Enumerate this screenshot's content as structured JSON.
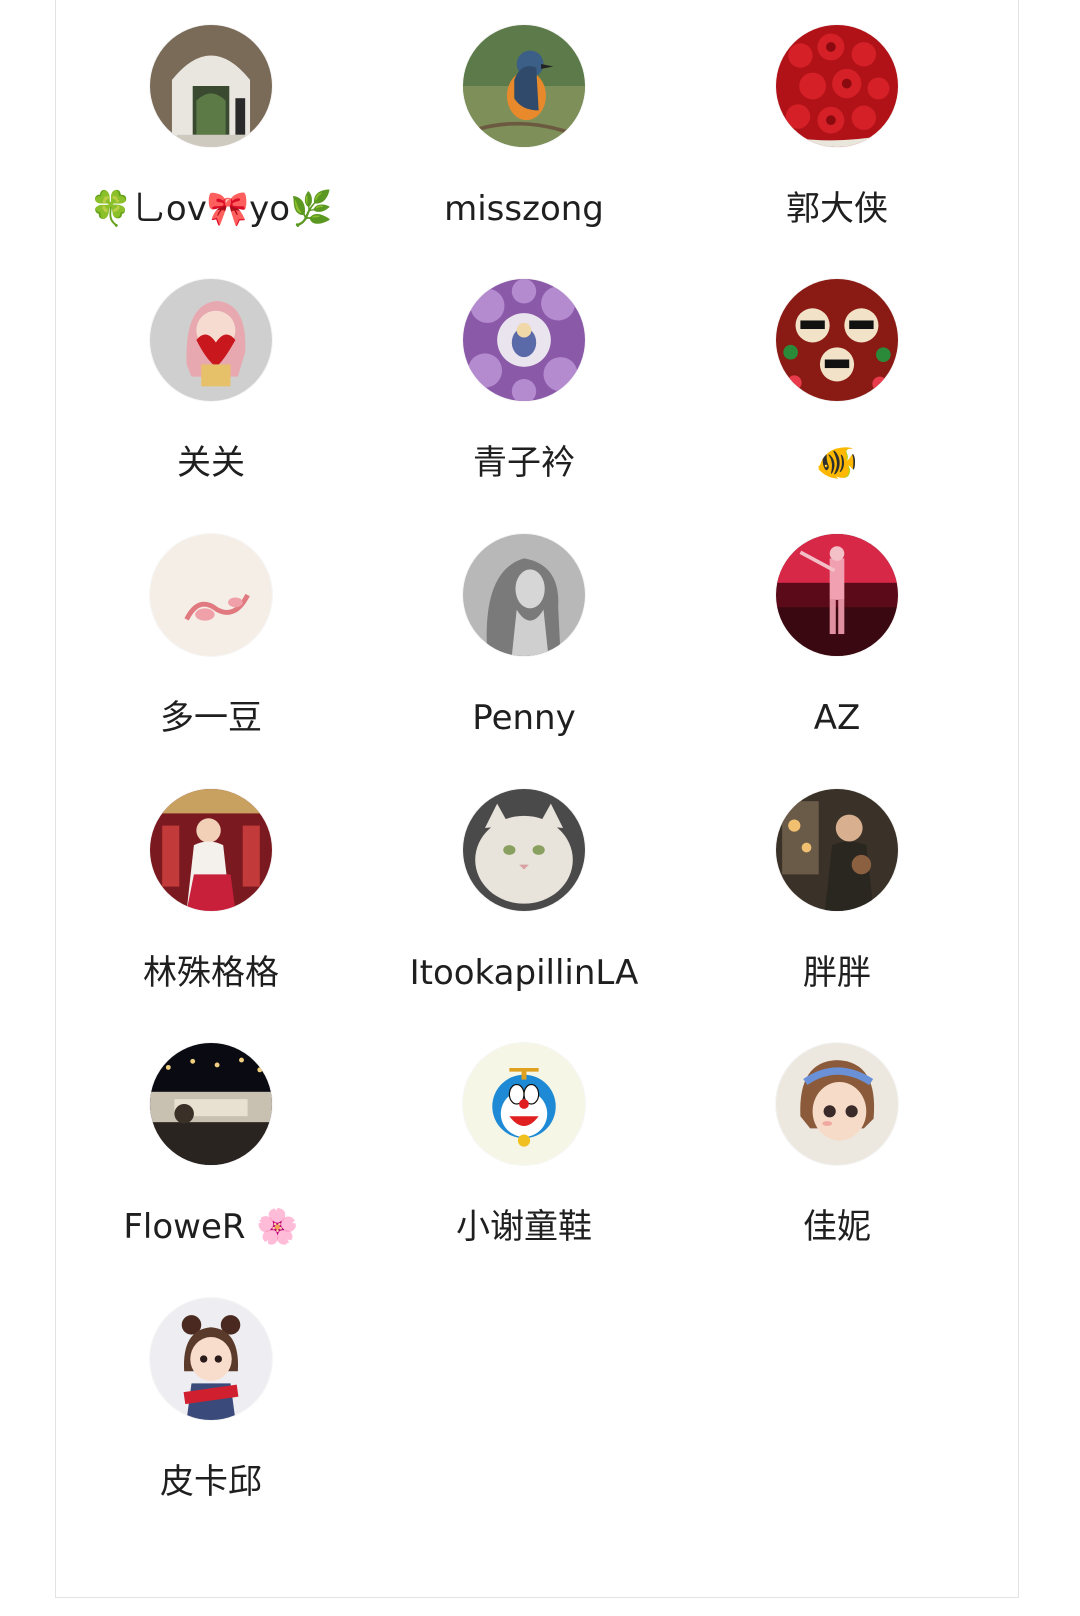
{
  "members": [
    {
      "name": "🍀乚ov🎀yo🌿",
      "avatar": "archway-photo"
    },
    {
      "name": "misszong",
      "avatar": "bird-photo"
    },
    {
      "name": "郭大侠",
      "avatar": "roses-photo"
    },
    {
      "name": "关关",
      "avatar": "cartoon-girl-heart"
    },
    {
      "name": "青子衿",
      "avatar": "purple-flowers-ring"
    },
    {
      "name": "🐠",
      "avatar": "red-cartoon-sunglasses"
    },
    {
      "name": "多一豆",
      "avatar": "pink-drawing"
    },
    {
      "name": "Penny",
      "avatar": "sketch-woman"
    },
    {
      "name": "AZ",
      "avatar": "red-neon-figure"
    },
    {
      "name": "林殊格格",
      "avatar": "hanfu-girl-photo"
    },
    {
      "name": "ItookapillinLA",
      "avatar": "white-cat-photo"
    },
    {
      "name": "胖胖",
      "avatar": "cafe-photo"
    },
    {
      "name": "FloweR 🌸",
      "avatar": "night-street-photo"
    },
    {
      "name": "小谢童鞋",
      "avatar": "doraemon"
    },
    {
      "name": "佳妮",
      "avatar": "cartoon-girl-headband"
    },
    {
      "name": "皮卡邱",
      "avatar": "cartoon-girl-buns"
    }
  ]
}
